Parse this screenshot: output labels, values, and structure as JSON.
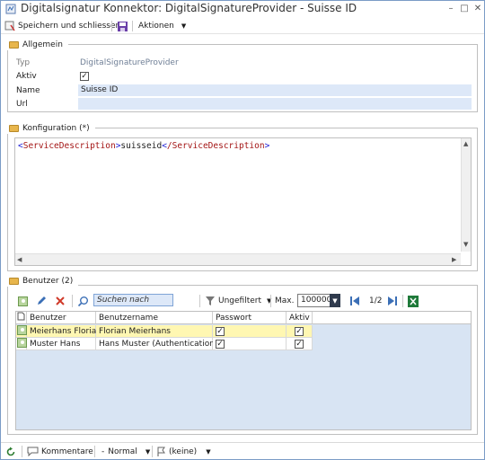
{
  "window": {
    "title": "Digitalsignatur Konnektor: DigitalSignatureProvider - Suisse ID"
  },
  "toolbar": {
    "save_close": "Speichern und schliessen",
    "actions": "Aktionen"
  },
  "allgemein": {
    "header": "Allgemein",
    "typ_label": "Typ",
    "typ_value": "DigitalSignatureProvider",
    "aktiv_label": "Aktiv",
    "aktiv_checked": true,
    "name_label": "Name",
    "name_value": "Suisse ID",
    "url_label": "Url",
    "url_value": ""
  },
  "konfiguration": {
    "header": "Konfiguration (*)",
    "open_tag": "ServiceDescription",
    "content": "suisseid",
    "close_tag": "/ServiceDescription"
  },
  "benutzer": {
    "header": "Benutzer (2)",
    "search_placeholder": "Suchen nach",
    "filter_label": "Ungefiltert",
    "max_label": "Max.",
    "max_value": "100000",
    "page": "1/2",
    "columns": [
      "Benutzer",
      "Benutzername",
      "Passwort",
      "Aktiv"
    ],
    "rows": [
      {
        "benutzer": "Meierhans Florian",
        "benutzername": "Florian Meierhans",
        "passwort": true,
        "aktiv": true
      },
      {
        "benutzer": "Muster Hans",
        "benutzername": "Hans Muster (Authentication)",
        "passwort": true,
        "aktiv": true
      }
    ]
  },
  "statusbar": {
    "comments": "Kommentare",
    "priority": "Normal",
    "flag": "(keine)"
  },
  "colors": {
    "accent": "#3b6fb6",
    "field_bg": "#dde8f8",
    "highlight_row": "#fff7b2",
    "grid_bg": "#d8e4f3"
  },
  "icons": [
    "window-icon",
    "minimize-icon",
    "maximize-icon",
    "close-icon",
    "save-close-icon",
    "save-icon",
    "folder-icon",
    "user-icon",
    "edit-icon",
    "delete-icon",
    "search-icon",
    "filter-icon",
    "first-page-icon",
    "last-page-icon",
    "excel-icon",
    "refresh-icon",
    "comment-icon",
    "flag-icon"
  ]
}
